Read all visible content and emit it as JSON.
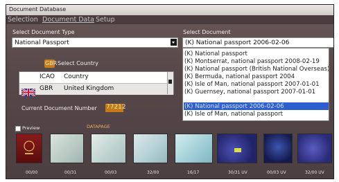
{
  "window": {
    "title": "Document Database"
  },
  "tabs": [
    "Selection",
    "Document Data",
    "Setup"
  ],
  "left": {
    "select_type_label": "Select Document Type",
    "doc_type_value": "National Passport",
    "country_badge": "GBR",
    "select_country_label": "Select Country",
    "country_table": {
      "header": [
        "ICAO",
        "Country"
      ],
      "rows": [
        {
          "code": "GBR",
          "country": "United Kingdom"
        }
      ]
    },
    "current_doc_label": "Current Document Number",
    "current_doc_number": "77212",
    "preview_label": "Preview",
    "datapage_label": "DATAPAGE"
  },
  "right": {
    "select_doc_label": "Select Document",
    "doc_value": "(K) National passport 2006-02-06",
    "doc_list": [
      "(K) National passport",
      "(K) Montserrat, national passport 2008-02-19",
      "(K) National passport (British National Overseas)",
      "(K) Bermuda, national passport 2004",
      "(K) Isle of Man, national passport 2007-01-01",
      "(K) Guernsey, national passport 2007-01-01",
      "(K) National passport 2006-02-06",
      "(K) Isle of Man, national passport"
    ],
    "selected_index": 6
  },
  "thumbnails": [
    {
      "label": "00/00",
      "color": "#7a1515"
    },
    {
      "label": "00/31",
      "color": "#b9c8c5"
    },
    {
      "label": "00/03",
      "color": "#c9d8d4"
    },
    {
      "label": "32/00",
      "color": "#c3d6d8"
    },
    {
      "label": "16/17",
      "color": "#a9d0d6"
    },
    {
      "label": "30/31 UV",
      "color": "#2b2d80"
    },
    {
      "label": "00/03 UV",
      "color": "#1c2155"
    },
    {
      "label": "32/00 UV",
      "color": "#3a3a8a"
    }
  ]
}
